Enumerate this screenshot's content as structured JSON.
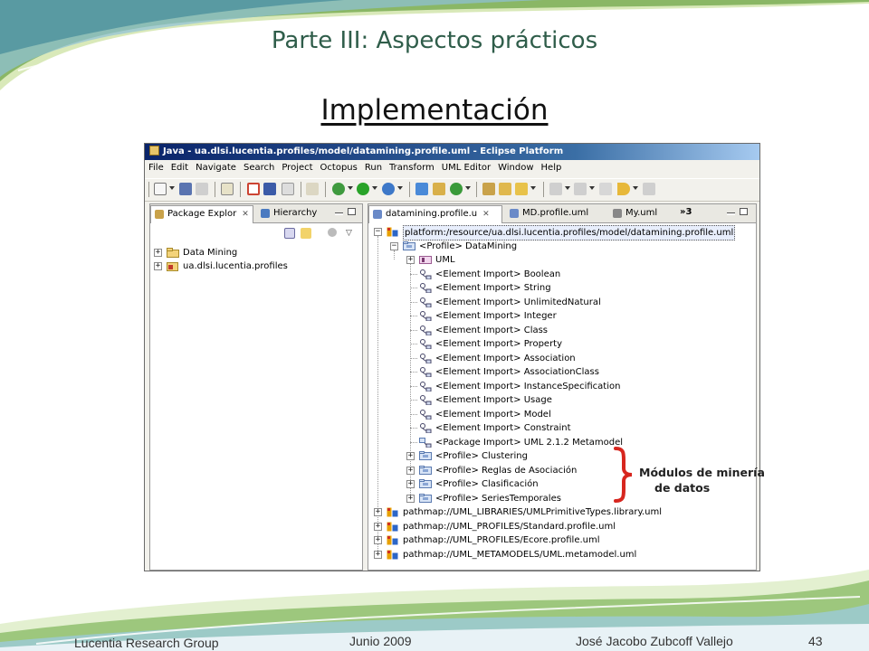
{
  "slide": {
    "title": "Parte III: Aspectos prácticos",
    "subtitle": "Implementación",
    "callout_line1": "Módulos de minería",
    "callout_line2": "de datos",
    "footer_left": "Lucentia Research Group",
    "footer_center": "Junio  2009",
    "footer_right": "José Jacobo Zubcoff Vallejo",
    "page_number": "43"
  },
  "window": {
    "title": "Java - ua.dlsi.lucentia.profiles/model/datamining.profile.uml - Eclipse Platform",
    "menu": [
      "File",
      "Edit",
      "Navigate",
      "Search",
      "Project",
      "Octopus",
      "Run",
      "Transform",
      "UML Editor",
      "Window",
      "Help"
    ]
  },
  "left_view": {
    "tabs": [
      "Package Explor",
      "Hierarchy"
    ],
    "items": [
      "Data Mining",
      "ua.dlsi.lucentia.profiles"
    ]
  },
  "editor": {
    "tabs": [
      "datamining.profile.u",
      "MD.profile.uml",
      "My.uml"
    ],
    "overflow_label": "»3",
    "tree": [
      {
        "label": "platform:/resource/ua.dlsi.lucentia.profiles/model/datamining.profile.uml",
        "level": 0,
        "exp": "-",
        "icon": "resource"
      },
      {
        "label": "<Profile> DataMining",
        "level": 1,
        "exp": "-",
        "icon": "profile"
      },
      {
        "label": "UML",
        "level": 2,
        "exp": "+",
        "icon": "model"
      },
      {
        "label": "<Element Import> Boolean",
        "level": 2,
        "exp": "",
        "icon": "import"
      },
      {
        "label": "<Element Import> String",
        "level": 2,
        "exp": "",
        "icon": "import"
      },
      {
        "label": "<Element Import> UnlimitedNatural",
        "level": 2,
        "exp": "",
        "icon": "import"
      },
      {
        "label": "<Element Import> Integer",
        "level": 2,
        "exp": "",
        "icon": "import"
      },
      {
        "label": "<Element Import> Class",
        "level": 2,
        "exp": "",
        "icon": "import"
      },
      {
        "label": "<Element Import> Property",
        "level": 2,
        "exp": "",
        "icon": "import"
      },
      {
        "label": "<Element Import> Association",
        "level": 2,
        "exp": "",
        "icon": "import"
      },
      {
        "label": "<Element Import> AssociationClass",
        "level": 2,
        "exp": "",
        "icon": "import"
      },
      {
        "label": "<Element Import> InstanceSpecification",
        "level": 2,
        "exp": "",
        "icon": "import"
      },
      {
        "label": "<Element Import> Usage",
        "level": 2,
        "exp": "",
        "icon": "import"
      },
      {
        "label": "<Element Import> Model",
        "level": 2,
        "exp": "",
        "icon": "import"
      },
      {
        "label": "<Element Import> Constraint",
        "level": 2,
        "exp": "",
        "icon": "import"
      },
      {
        "label": "<Package Import> UML 2.1.2 Metamodel",
        "level": 2,
        "exp": "",
        "icon": "pkgimport"
      },
      {
        "label": "<Profile> Clustering",
        "level": 2,
        "exp": "+",
        "icon": "profile"
      },
      {
        "label": "<Profile> Reglas de Asociación",
        "level": 2,
        "exp": "+",
        "icon": "profile"
      },
      {
        "label": "<Profile> Clasificación",
        "level": 2,
        "exp": "+",
        "icon": "profile"
      },
      {
        "label": "<Profile> SeriesTemporales",
        "level": 2,
        "exp": "+",
        "icon": "profile"
      },
      {
        "label": "pathmap://UML_LIBRARIES/UMLPrimitiveTypes.library.uml",
        "level": 0,
        "exp": "+",
        "icon": "resource"
      },
      {
        "label": "pathmap://UML_PROFILES/Standard.profile.uml",
        "level": 0,
        "exp": "+",
        "icon": "resource"
      },
      {
        "label": "pathmap://UML_PROFILES/Ecore.profile.uml",
        "level": 0,
        "exp": "+",
        "icon": "resource"
      },
      {
        "label": "pathmap://UML_METAMODELS/UML.metamodel.uml",
        "level": 0,
        "exp": "+",
        "icon": "resource"
      }
    ]
  },
  "colors": {
    "title_green": "#2f5d4a",
    "brace_red": "#d7261f",
    "titlebar": "#0a246a"
  }
}
